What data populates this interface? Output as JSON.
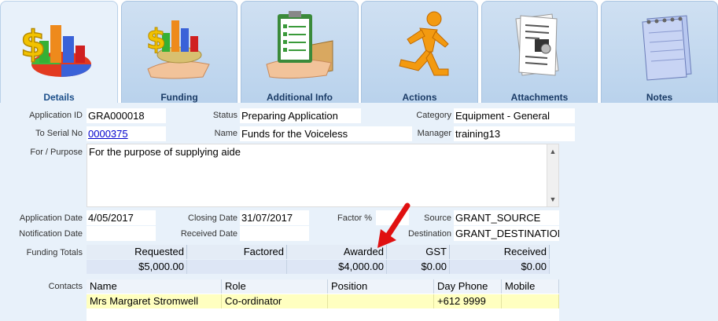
{
  "tabs": [
    {
      "label": "Details",
      "icon": "finance-chart-icon"
    },
    {
      "label": "Funding",
      "icon": "money-hand-icon"
    },
    {
      "label": "Additional Info",
      "icon": "clipboard-box-icon"
    },
    {
      "label": "Actions",
      "icon": "running-man-icon"
    },
    {
      "label": "Attachments",
      "icon": "paperclip-documents-icon"
    },
    {
      "label": "Notes",
      "icon": "notepad-icon"
    }
  ],
  "form": {
    "application_id_label": "Application ID",
    "application_id": "GRA000018",
    "status_label": "Status",
    "status": "Preparing Application",
    "category_label": "Category",
    "category": "Equipment - General",
    "to_serial_label": "To Serial No",
    "to_serial": "0000375",
    "name_label": "Name",
    "name": "Funds for the Voiceless",
    "manager_label": "Manager",
    "manager": "training13",
    "purpose_label": "For / Purpose",
    "purpose": "For the purpose of supplying aide",
    "application_date_label": "Application Date",
    "application_date": "4/05/2017",
    "closing_date_label": "Closing Date",
    "closing_date": "31/07/2017",
    "factor_label": "Factor %",
    "factor": "",
    "source_label": "Source",
    "source": "GRANT_SOURCE",
    "notification_date_label": "Notification Date",
    "notification_date": "",
    "received_date_label": "Received Date",
    "received_date": "",
    "destination_label": "Destination",
    "destination": "GRANT_DESTINATION"
  },
  "funding_totals": {
    "label": "Funding Totals",
    "headers": [
      "Requested",
      "Factored",
      "Awarded",
      "GST",
      "Received"
    ],
    "values": [
      "$5,000.00",
      "",
      "$4,000.00",
      "$0.00",
      "$0.00"
    ]
  },
  "contacts": {
    "label": "Contacts",
    "headers": [
      "Name",
      "Role",
      "Position",
      "Day Phone",
      "Mobile"
    ],
    "rows": [
      [
        "Mrs Margaret Stromwell",
        "Co-ordinator",
        "",
        "+612 9999",
        ""
      ]
    ]
  },
  "colors": {
    "background": "#e8f1fa",
    "tab": "#c5daf0",
    "arrow": "#e01010",
    "selected_row": "#ffffc0"
  }
}
